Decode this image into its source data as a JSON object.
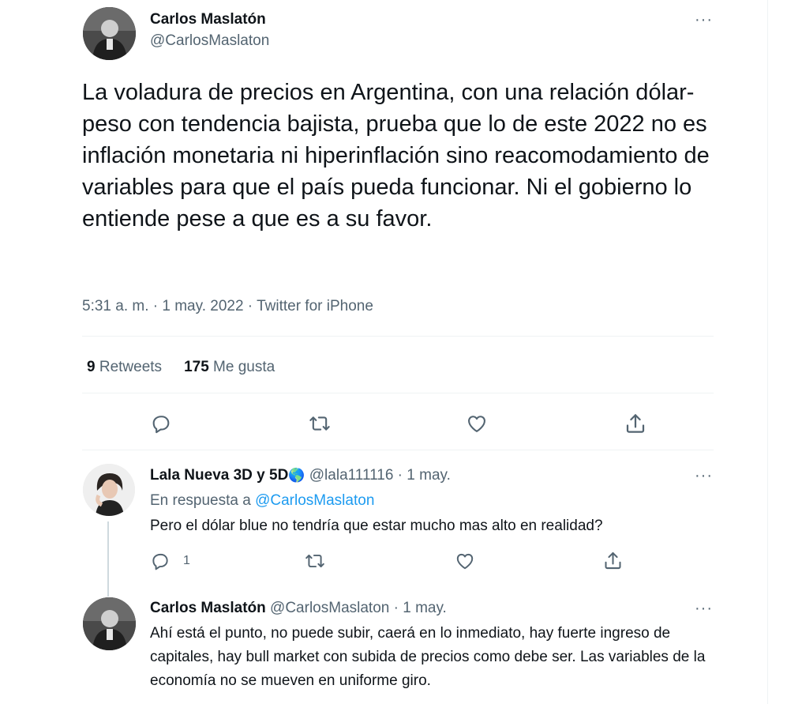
{
  "main_tweet": {
    "author_name": "Carlos Maslatón",
    "author_handle": "@CarlosMaslaton",
    "text": "La voladura de precios en Argentina, con una relación dólar-peso con tendencia bajista, prueba que lo de este 2022 no es inflación monetaria ni hiperinflación sino reacomodamiento de variables para que el país pueda funcionar. Ni el gobierno lo entiende pese a que es a su favor.",
    "meta": "5:31 a. m. · 1 may. 2022 · Twitter for iPhone",
    "retweets_count": "9",
    "retweets_label": "Retweets",
    "likes_count": "175",
    "likes_label": "Me gusta"
  },
  "replies": [
    {
      "author_name": "Lala Nueva 3D y 5D",
      "emoji": "🌎",
      "author_handle": "@lala111116",
      "date": "· 1 may.",
      "reply_to_prefix": "En respuesta a",
      "reply_to_handle": "@CarlosMaslaton",
      "text": "Pero el dólar blue no tendría que estar mucho mas alto en realidad?",
      "reply_count": "1"
    },
    {
      "author_name": "Carlos Maslatón",
      "author_handle": "@CarlosMaslaton",
      "date": "· 1 may.",
      "text": "Ahí está el punto, no puede subir, caerá en lo inmediato, hay fuerte ingreso de capitales, hay bull market con subida de precios como debe ser. Las variables de la economía no se mueven en uniforme giro."
    }
  ],
  "more_glyph": "···",
  "icons": [
    "more-icon",
    "reply-icon",
    "retweet-icon",
    "like-icon",
    "share-icon"
  ]
}
